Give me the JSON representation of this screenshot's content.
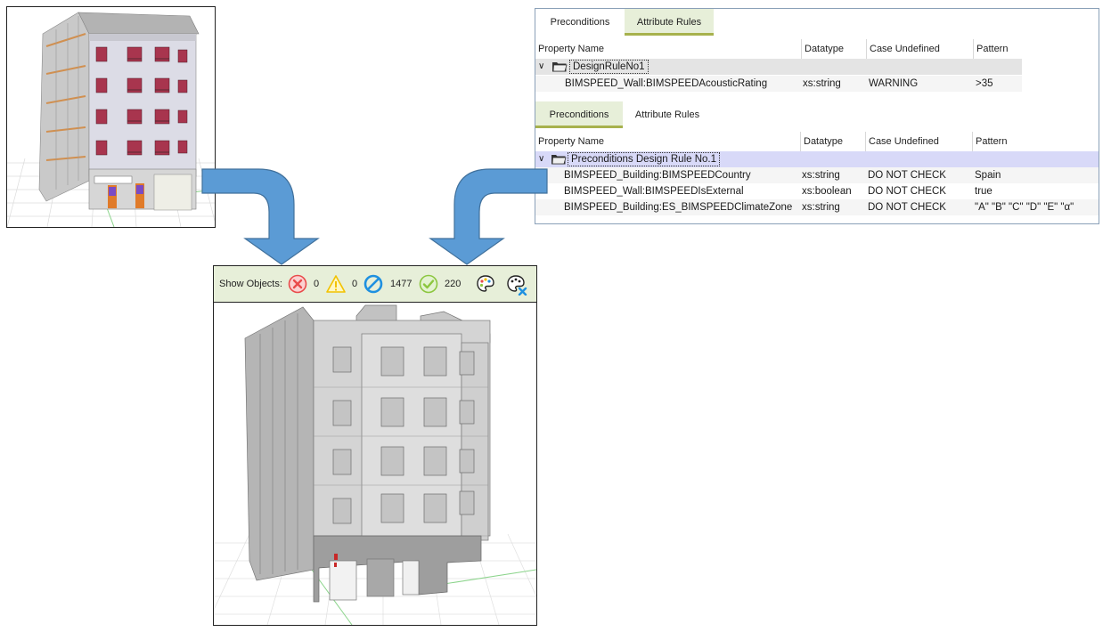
{
  "panel": {
    "tabs_top": [
      {
        "label": "Preconditions"
      },
      {
        "label": "Attribute Rules"
      }
    ],
    "tabs_bottom": [
      {
        "label": "Preconditions"
      },
      {
        "label": "Attribute Rules"
      }
    ],
    "columns": [
      "Property Name",
      "Datatype",
      "Case Undefined",
      "Pattern"
    ],
    "attribute_rules": {
      "group_label": "DesignRuleNo1",
      "rows": [
        {
          "property": "BIMSPEED_Wall:BIMSPEEDAcousticRating",
          "datatype": "xs:string",
          "case_undefined": "WARNING",
          "pattern": ">35"
        }
      ]
    },
    "preconditions": {
      "group_label": "Preconditions Design Rule No.1",
      "rows": [
        {
          "property": "BIMSPEED_Building:BIMSPEEDCountry",
          "datatype": "xs:string",
          "case_undefined": "DO NOT CHECK",
          "pattern": "Spain"
        },
        {
          "property": "BIMSPEED_Wall:BIMSPEEDIsExternal",
          "datatype": "xs:boolean",
          "case_undefined": "DO NOT CHECK",
          "pattern": "true"
        },
        {
          "property": "BIMSPEED_Building:ES_BIMSPEEDClimateZone",
          "datatype": "xs:string",
          "case_undefined": "DO NOT CHECK",
          "pattern": "\"A\" \"B\" \"C\" \"D\" \"E\" \"α\""
        }
      ]
    }
  },
  "toolbar": {
    "label": "Show Objects:",
    "error_count": "0",
    "warning_count": "0",
    "unchecked_count": "1477",
    "passed_count": "220",
    "icons": [
      "error-icon",
      "warning-icon",
      "unchecked-icon",
      "passed-icon",
      "color-palette-icon",
      "clear-colors-icon"
    ]
  },
  "colors": {
    "tab_active": "#e7efd9",
    "tab_underline": "#a7b24d",
    "arrow": "#5b9bd5",
    "arrow_border": "#41719c",
    "error": "#e94b4b",
    "warning": "#f2c200",
    "unchecked": "#1e90e0",
    "passed": "#8cc63f"
  }
}
